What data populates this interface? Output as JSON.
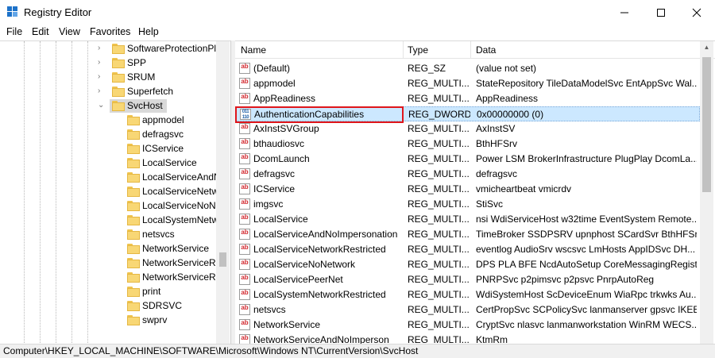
{
  "window": {
    "title": "Registry Editor"
  },
  "menu": [
    "File",
    "Edit",
    "View",
    "Favorites",
    "Help"
  ],
  "tree": [
    {
      "label": "SoftwareProtectionPl",
      "chevron": "›",
      "level": 1
    },
    {
      "label": "SPP",
      "chevron": "›",
      "level": 1
    },
    {
      "label": "SRUM",
      "chevron": "›",
      "level": 1
    },
    {
      "label": "Superfetch",
      "chevron": "›",
      "level": 1
    },
    {
      "label": "SvcHost",
      "chevron": "⌄",
      "level": 1,
      "selected": true
    },
    {
      "label": "appmodel",
      "level": 2
    },
    {
      "label": "defragsvc",
      "level": 2
    },
    {
      "label": "ICService",
      "level": 2
    },
    {
      "label": "LocalService",
      "level": 2
    },
    {
      "label": "LocalServiceAndN",
      "level": 2
    },
    {
      "label": "LocalServiceNetw",
      "level": 2
    },
    {
      "label": "LocalServiceNoNe",
      "level": 2
    },
    {
      "label": "LocalSystemNetw",
      "level": 2
    },
    {
      "label": "netsvcs",
      "level": 2
    },
    {
      "label": "NetworkService",
      "level": 2
    },
    {
      "label": "NetworkServiceRe",
      "level": 2
    },
    {
      "label": "NetworkServiceRe",
      "level": 2
    },
    {
      "label": "print",
      "level": 2
    },
    {
      "label": "SDRSVC",
      "level": 2
    },
    {
      "label": "swprv",
      "level": 2
    }
  ],
  "columns": {
    "name": "Name",
    "type": "Type",
    "data": "Data"
  },
  "values": [
    {
      "icon": "ab",
      "name": "(Default)",
      "type": "REG_SZ",
      "data": "(value not set)"
    },
    {
      "icon": "ab",
      "name": "appmodel",
      "type": "REG_MULTI...",
      "data": "StateRepository TileDataModelSvc EntAppSvc Wal..."
    },
    {
      "icon": "ab",
      "name": "AppReadiness",
      "type": "REG_MULTI...",
      "data": "AppReadiness"
    },
    {
      "icon": "bin",
      "name": "AuthenticationCapabilities",
      "type": "REG_DWORD",
      "data": "0x00000000 (0)",
      "selected": true
    },
    {
      "icon": "ab",
      "name": "AxInstSVGroup",
      "type": "REG_MULTI...",
      "data": "AxInstSV"
    },
    {
      "icon": "ab",
      "name": "bthaudiosvc",
      "type": "REG_MULTI...",
      "data": "BthHFSrv"
    },
    {
      "icon": "ab",
      "name": "DcomLaunch",
      "type": "REG_MULTI...",
      "data": "Power LSM BrokerInfrastructure PlugPlay DcomLa..."
    },
    {
      "icon": "ab",
      "name": "defragsvc",
      "type": "REG_MULTI...",
      "data": "defragsvc"
    },
    {
      "icon": "ab",
      "name": "ICService",
      "type": "REG_MULTI...",
      "data": "vmicheartbeat vmicrdv"
    },
    {
      "icon": "ab",
      "name": "imgsvc",
      "type": "REG_MULTI...",
      "data": "StiSvc"
    },
    {
      "icon": "ab",
      "name": "LocalService",
      "type": "REG_MULTI...",
      "data": "nsi WdiServiceHost w32time EventSystem Remote..."
    },
    {
      "icon": "ab",
      "name": "LocalServiceAndNoImpersonation",
      "type": "REG_MULTI...",
      "data": "TimeBroker SSDPSRV upnphost SCardSvr BthHFSr..."
    },
    {
      "icon": "ab",
      "name": "LocalServiceNetworkRestricted",
      "type": "REG_MULTI...",
      "data": "eventlog AudioSrv wscsvc LmHosts AppIDSvc DH..."
    },
    {
      "icon": "ab",
      "name": "LocalServiceNoNetwork",
      "type": "REG_MULTI...",
      "data": "DPS PLA BFE NcdAutoSetup CoreMessagingRegist..."
    },
    {
      "icon": "ab",
      "name": "LocalServicePeerNet",
      "type": "REG_MULTI...",
      "data": "PNRPSvc p2pimsvc p2psvc PnrpAutoReg"
    },
    {
      "icon": "ab",
      "name": "LocalSystemNetworkRestricted",
      "type": "REG_MULTI...",
      "data": "WdiSystemHost ScDeviceEnum WiaRpc trkwks Au..."
    },
    {
      "icon": "ab",
      "name": "netsvcs",
      "type": "REG_MULTI...",
      "data": "CertPropSvc SCPolicySvc lanmanserver gpsvc IKEE..."
    },
    {
      "icon": "ab",
      "name": "NetworkService",
      "type": "REG_MULTI...",
      "data": "CryptSvc nlasvc lanmanworkstation WinRM WECS..."
    },
    {
      "icon": "ab",
      "name": "NetworkServiceAndNoImperson",
      "type": "REG_MULTI...",
      "data": "KtmRm"
    }
  ],
  "status": {
    "path": "Computer\\HKEY_LOCAL_MACHINE\\SOFTWARE\\Microsoft\\Windows NT\\CurrentVersion\\SvcHost"
  },
  "colors": {
    "selection": "#cce8ff",
    "highlight_box": "#e0161b",
    "folder": "#f8d775"
  }
}
